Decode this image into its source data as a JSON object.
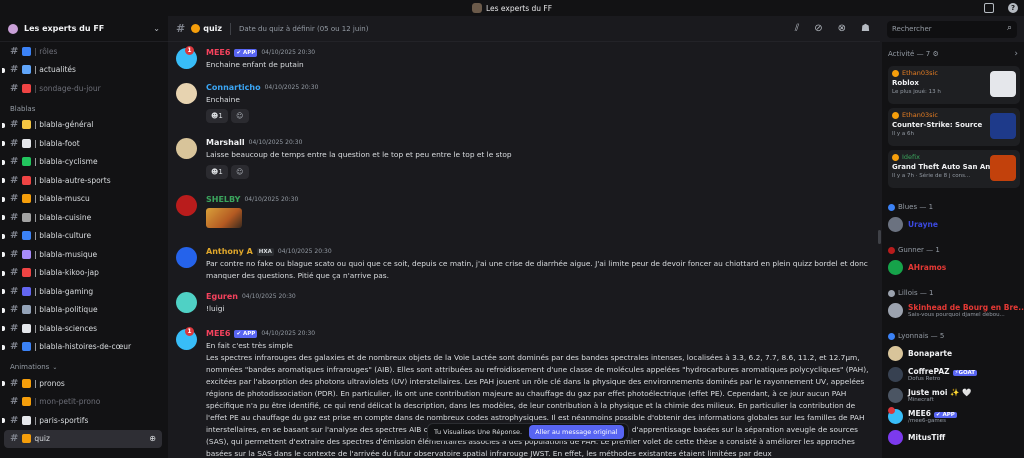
{
  "window": {
    "title": "Les experts du FF"
  },
  "server": {
    "name": "Les experts du FF"
  },
  "sidebar": {
    "top_channels": [
      {
        "label": "rôles",
        "muted": true,
        "emoji_color": "#3b82f6"
      },
      {
        "label": "actualités",
        "muted": false,
        "emoji_color": "#60a5fa"
      },
      {
        "label": "sondage-du-jour",
        "muted": true,
        "emoji_color": "#ef4444",
        "emoji": "❓"
      }
    ],
    "category_blablas": "Blablas",
    "blablas": [
      {
        "label": "blabla-général",
        "emoji_color": "#f4c542"
      },
      {
        "label": "blabla-foot",
        "emoji_color": "#e5e7eb"
      },
      {
        "label": "blabla-cyclisme",
        "emoji_color": "#22c55e"
      },
      {
        "label": "blabla-autre-sports",
        "emoji_color": "#ef4444"
      },
      {
        "label": "blabla-muscu",
        "emoji_color": "#f59e0b"
      },
      {
        "label": "blabla-cuisine",
        "emoji_color": "#a3a3a3"
      },
      {
        "label": "blabla-culture",
        "emoji_color": "#3b82f6"
      },
      {
        "label": "blabla-musique",
        "emoji_color": "#a78bfa"
      },
      {
        "label": "blabla-kikoo-jap",
        "emoji_color": "#ef4444"
      },
      {
        "label": "blabla-gaming",
        "emoji_color": "#6366f1"
      },
      {
        "label": "blabla-politique",
        "emoji_color": "#94a3b8"
      },
      {
        "label": "blabla-sciences",
        "emoji_color": "#e5e7eb"
      },
      {
        "label": "blabla-histoires-de-cœur",
        "emoji_color": "#3b82f6"
      }
    ],
    "category_animations": "Animations",
    "animations": [
      {
        "label": "pronos",
        "muted": false,
        "emoji_color": "#f59e0b"
      },
      {
        "label": "mon-petit-prono",
        "muted": true,
        "emoji_color": "#f59e0b"
      },
      {
        "label": "paris-sportifs",
        "muted": false,
        "emoji_color": "#e5e7eb"
      },
      {
        "label": "quiz",
        "muted": false,
        "active": true,
        "emoji_color": "#f59e0b"
      }
    ]
  },
  "channel": {
    "name": "quiz",
    "topic": "Date du quiz à définir (05 ou 12 juin)"
  },
  "search": {
    "placeholder": "Rechercher"
  },
  "messages": [
    {
      "author": "MEE6",
      "color": "#f5425d",
      "tag": "✔ APP",
      "ts": "04/10/2025 20:30",
      "text": "Enchaine enfant de putain",
      "avatar": "#38bdf8"
    },
    {
      "author": "Connarticho",
      "color": "#3ba6f5",
      "ts": "04/10/2025 20:30",
      "text": "Enchaine",
      "avatar": "#e7d3b0",
      "react_count": "1"
    },
    {
      "author": "Marshall",
      "color": "#f2f3f5",
      "ts": "04/10/2025 20:30",
      "text": "Laisse beaucoup de temps entre la question et le top et peu entre le top et le stop",
      "avatar": "#d8c49a",
      "react_count": "1"
    },
    {
      "author": "SHELBY",
      "color": "#3ba55d",
      "ts": "04/10/2025 20:30",
      "text": "",
      "avatar": "#b91c1c"
    },
    {
      "author": "Anthony A",
      "color": "#e0a72b",
      "tag": "HXA",
      "ts": "04/10/2025 20:30",
      "text": "Par contre no fake ou blague scato ou quoi que ce soit, depuis ce matin, j'ai une crise de diarrhée aigue. J'ai limite peur de devoir foncer au chiottard en plein quizz bordel et donc manquer des questions.    Pitié que ça n'arrive pas.",
      "avatar": "#2563eb"
    },
    {
      "author": "Eguren",
      "color": "#f5425d",
      "ts": "04/10/2025 20:30",
      "text": "!luigi",
      "avatar": "#4fd1c5"
    },
    {
      "author": "MEE6",
      "color": "#f5425d",
      "tag": "✔ APP",
      "ts": "04/10/2025 20:30",
      "text": "En fait c'est très simple\nLes spectres infrarouges des galaxies et de nombreux objets de la Voie Lactée sont dominés par des bandes spectrales intenses, localisées à 3.3, 6.2, 7.7, 8.6, 11.2, et 12.7μm, nommées \"bandes aromatiques infrarouges\" (AIB). Elles sont attribuées au refroidissement d'une classe de molécules appelées \"hydrocarbures aromatiques polycycliques\" (PAH), excitées par l'absorption des photons ultraviolets (UV) interstellaires. Les PAH jouent un rôle clé dans la physique des environnements dominés par le rayonnement UV, appelées régions de photodissociation (PDR). En particulier, ils ont une contribution majeure au chauffage du gaz par effet photoélectrique (effet PE). Cependant, à ce jour aucun PAH spécifique n'a pu être identifié, ce qui rend délicat la description, dans les modèles, de leur contribution à la physique et la chimie des milieux. En particulier la contribution de l'effet PE au chauffage du gaz est prise en compte dans de nombreux codes astrophysiques. Il est néanmoins possible d'obtenir des informations globales sur les familles de PAH interstellaires, en se basant sur l'analyse des spectres AIB observés. Dans ce but, nous avons utilisé les méthodes d'apprentissage basées sur la séparation aveugle de sources (SAS), qui permettent d'extraire des spectres d'émission élémentaires associés à des populations de PAH. Le premier volet de cette thèse a consisté à améliorer les approches basées sur la SAS dans le contexte de l'arrivée du futur observatoire spatial infrarouge JWST. En effet, les méthodes existantes étaient limitées par deux",
      "avatar": "#38bdf8"
    }
  ],
  "toast": {
    "text": "Tu Visualises Une Réponse.",
    "button": "Aller au message original"
  },
  "members": {
    "activity_label": "Activité — 7 ⚙",
    "activities": [
      {
        "user": "Ethan03sic",
        "game": "Roblox",
        "sub": "Le plus joué: 13 h",
        "thumb": "#e5e7eb"
      },
      {
        "user": "Ethan03sic",
        "game": "Counter-Strike: Source",
        "sub": "Il y a 6h",
        "thumb": "#1e3a8a"
      },
      {
        "user": "Idefix",
        "game": "Grand Theft Auto San And...",
        "sub": "Il y a 7h · Série de 8 j cons...",
        "thumb": "#c2410c",
        "user_color": "#3ba55d"
      }
    ],
    "groups": [
      {
        "label": "Blues — 1",
        "icon_color": "#3b82f6",
        "members": [
          {
            "name": "Urayne",
            "color": "#3b49e0",
            "status": "",
            "av": "#6b7280"
          }
        ]
      },
      {
        "label": "Gunner — 1",
        "icon_color": "#b91c1c",
        "members": [
          {
            "name": "AHramos",
            "color": "#e53935",
            "status": "",
            "av": "#16a34a"
          }
        ]
      },
      {
        "label": "Lillois — 1",
        "icon_color": "#9ca3af",
        "members": [
          {
            "name": "Skinhead de Bourg en Bre...",
            "color": "#e53935",
            "status": "Sais-vous pourquoi djamel débou...",
            "av": "#9ca3af"
          }
        ]
      },
      {
        "label": "Lyonnais — 5",
        "icon_color": "#3b82f6",
        "members": [
          {
            "name": "Bonaparte",
            "color": "#f2f3f5",
            "status": "",
            "av": "#d8c49a"
          },
          {
            "name": "CoffrePAZ",
            "color": "#f2f3f5",
            "tag": "⚡GOAT",
            "status": "Dofus Retro",
            "av": "#374151"
          },
          {
            "name": "Juste moi ✨ 🤍",
            "color": "#f2f3f5",
            "status": "Minecraft",
            "av": "#4b5563"
          },
          {
            "name": "MEE6",
            "color": "#f2f3f5",
            "tag": "✔ APP",
            "status": "/mee6-games",
            "av": "#38bdf8",
            "badge": true
          },
          {
            "name": "MitusTiff",
            "color": "#f2f3f5",
            "status": "",
            "av": "#7c3aed"
          }
        ]
      }
    ]
  },
  "colors": {
    "accent": "#5865f2",
    "mention": "#da373c"
  }
}
